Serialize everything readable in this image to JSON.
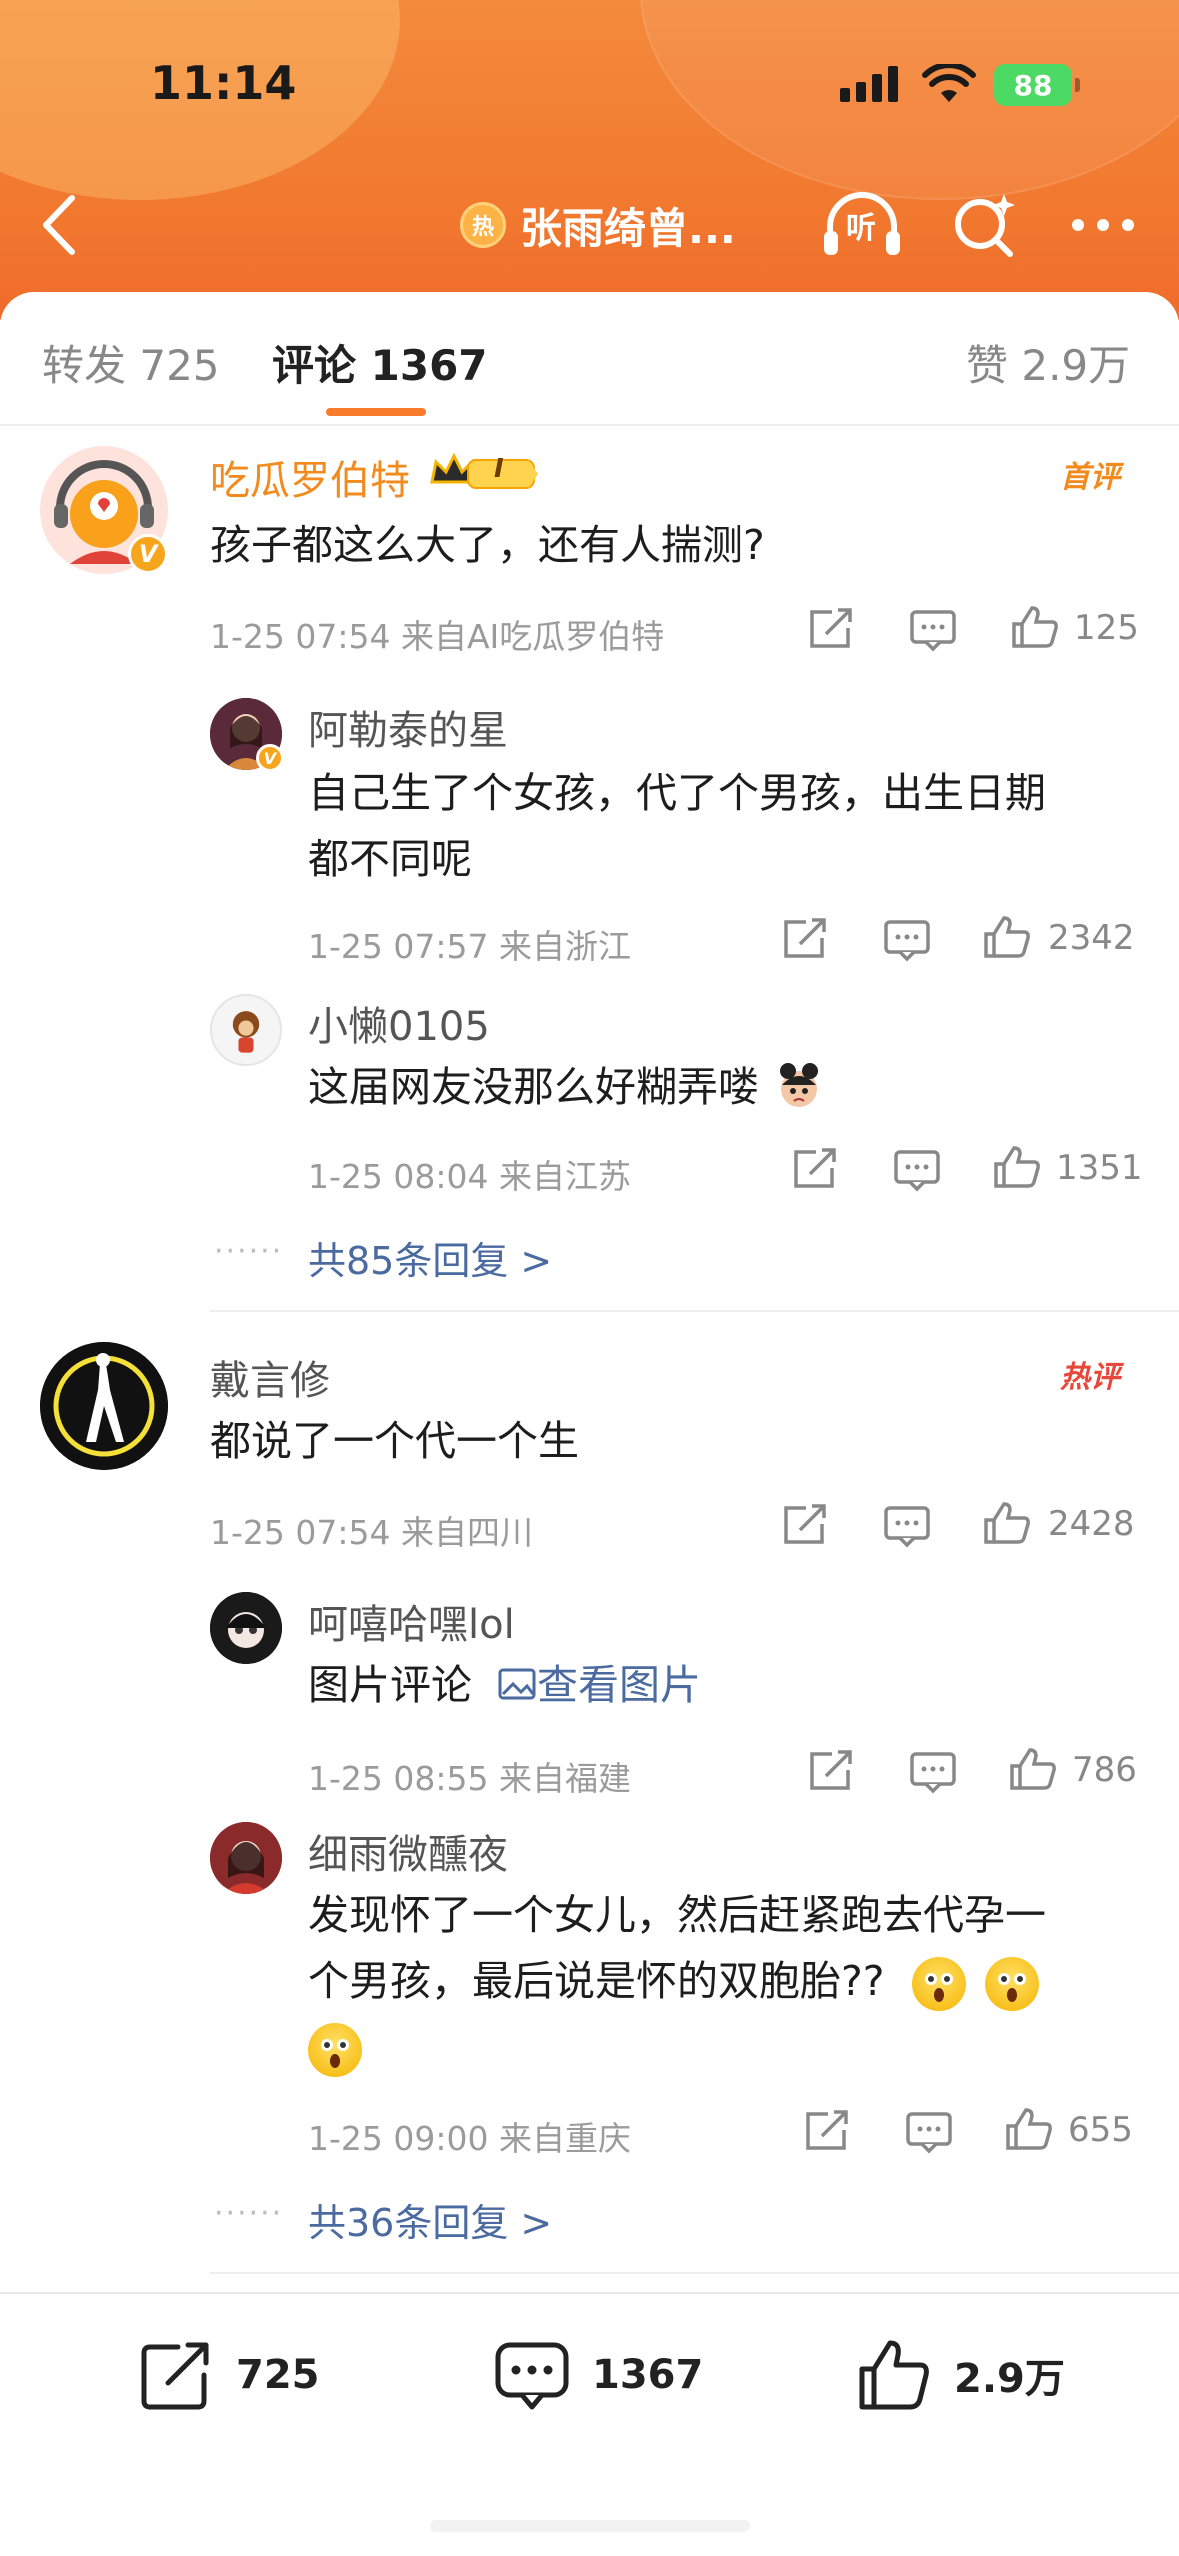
{
  "status_bar": {
    "time": "11:14",
    "battery": "88"
  },
  "nav": {
    "title": "张雨绮曾...",
    "hot_badge": "热",
    "listen_label": "听"
  },
  "tabs": {
    "repost": "转发 725",
    "comments": "评论 1367",
    "likes": "赞 2.9万"
  },
  "comments": [
    {
      "username": "吃瓜罗伯特",
      "vip_level": "I",
      "tag": "首评",
      "text": "孩子都这么大了，还有人揣测?",
      "meta": "1-25 07:54  来自AI吃瓜罗伯特",
      "likes": "125",
      "replies": [
        {
          "username": "阿勒泰的星",
          "text_line1": "自己生了个女孩，代了个男孩，出生日期",
          "text_line2": "都不同呢",
          "meta": "1-25 07:57  来自浙江",
          "likes": "2342"
        },
        {
          "username": "小懒0105",
          "text": "这届网友没那么好糊弄喽",
          "meta": "1-25 08:04  来自江苏",
          "likes": "1351"
        }
      ],
      "more_replies": "共85条回复 >"
    },
    {
      "username": "戴言修",
      "tag": "热评",
      "text": "都说了一个代一个生",
      "meta": "1-25 07:54  来自四川",
      "likes": "2428",
      "replies": [
        {
          "username": "呵嘻哈嘿lol",
          "text": "图片评论",
          "link": "查看图片",
          "meta": "1-25 08:55  来自福建",
          "likes": "786"
        },
        {
          "username": "细雨微醺夜",
          "text_line1": "发现怀了一个女儿，然后赶紧跑去代孕一",
          "text_line2": "个男孩，最后说是怀的双胞胎??",
          "meta": "1-25 09:00  来自重庆",
          "likes": "655"
        }
      ],
      "more_replies": "共36条回复 >"
    }
  ],
  "bottom_bar": {
    "repost": "725",
    "comments": "1367",
    "likes": "2.9万"
  },
  "colors": {
    "header": "#f27a30",
    "accent": "#f77b2a",
    "username_vip": "#f28a1e",
    "link": "#4a6aa0"
  }
}
